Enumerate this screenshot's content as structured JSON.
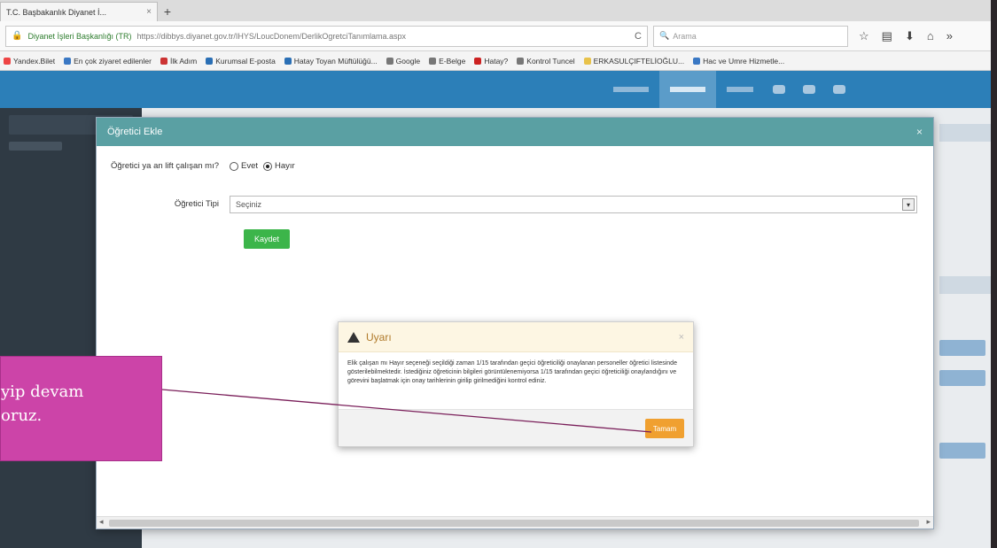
{
  "browser": {
    "tab_title": "T.C. Başbakanlık Diyanet İ...",
    "tab_close": "×",
    "new_tab": "+",
    "url_site": "Diyanet İşleri Başkanlığı (TR)",
    "url": "https://dibbys.diyanet.gov.tr/IHYS/LoucDonem/DerlikOgretciTanımlama.aspx",
    "reload": "C",
    "search_placeholder": "Arama",
    "bookmarks": [
      {
        "label": "Yandex.Bilet",
        "color": "#e44"
      },
      {
        "label": "En çok ziyaret edilenler",
        "color": "#3a78c4"
      },
      {
        "label": "İlk Adım",
        "color": "#c33"
      },
      {
        "label": "Kurumsal E-posta",
        "color": "#2a6fb5"
      },
      {
        "label": "Hatay Toyan Müftülüğü...",
        "color": "#2a6fb5"
      },
      {
        "label": "Google",
        "color": "#777"
      },
      {
        "label": "E-Belge",
        "color": "#777"
      },
      {
        "label": "Hatay?",
        "color": "#c22"
      },
      {
        "label": "Kontrol Tuncel",
        "color": "#777"
      },
      {
        "label": "ERKASULÇIFTELİOĞLU...",
        "color": "#e8c24a"
      },
      {
        "label": "Hac ve Umre Hizmetle...",
        "color": "#3a78c4"
      }
    ]
  },
  "modal": {
    "title": "Öğretici Ekle",
    "close": "×",
    "question_label": "Öğretici ya an lift çalışan mı?",
    "radio_yes": "Evet",
    "radio_no": "Hayır",
    "type_label": "Öğretici Tipi",
    "type_value": "Seçiniz",
    "save_label": "Kaydet"
  },
  "alert": {
    "title": "Uyarı",
    "close": "×",
    "body": "Elik çalışan mı Hayır seçeneği seçildiği zaman 1/15 tarafından geçici öğreticiliği onaylanan personeller öğretici listesinde gösterilebilmektedir. İstediğiniz öğreticinin bilgileri görüntülenemiyorsa 1/15 tarafından geçici öğreticiliği onaylandığını ve görevini başlatmak için onay tarihlerinin girilip girilmediğini kontrol ediniz.",
    "ok_label": "Tamam"
  },
  "annotation": {
    "line1": "yip devam",
    "line2": "oruz."
  },
  "colors": {
    "modal_header": "#5aa0a3",
    "save_button": "#3cb54a",
    "ok_button": "#f0a030",
    "annotation_bg": "#cc44a8",
    "app_header": "#2c7fb8"
  }
}
